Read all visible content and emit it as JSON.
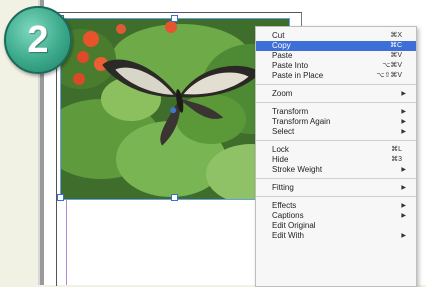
{
  "step": {
    "number": "2"
  },
  "colors": {
    "accent_select": "#3d6fd7",
    "badge": "#3ba98a",
    "guide": "#b38ad6"
  },
  "photo": {
    "description_icon": "butterfly-photo"
  },
  "menu": {
    "groups": [
      [
        {
          "label": "Cut",
          "shortcut": "⌘X"
        },
        {
          "label": "Copy",
          "shortcut": "⌘C",
          "selected": true
        },
        {
          "label": "Paste",
          "shortcut": "⌘V"
        },
        {
          "label": "Paste Into",
          "shortcut": "⌥⌘V"
        },
        {
          "label": "Paste in Place",
          "shortcut": "⌥⇧⌘V"
        }
      ],
      [
        {
          "label": "Zoom",
          "submenu": true
        }
      ],
      [
        {
          "label": "Transform",
          "submenu": true
        },
        {
          "label": "Transform Again",
          "submenu": true
        },
        {
          "label": "Select",
          "submenu": true
        }
      ],
      [
        {
          "label": "Lock",
          "shortcut": "⌘L"
        },
        {
          "label": "Hide",
          "shortcut": "⌘3"
        },
        {
          "label": "Stroke Weight",
          "submenu": true
        }
      ],
      [
        {
          "label": "Fitting",
          "submenu": true
        }
      ],
      [
        {
          "label": "Effects",
          "submenu": true
        },
        {
          "label": "Captions",
          "submenu": true
        },
        {
          "label": "Edit Original"
        },
        {
          "label": "Edit With",
          "submenu": true
        }
      ]
    ]
  }
}
